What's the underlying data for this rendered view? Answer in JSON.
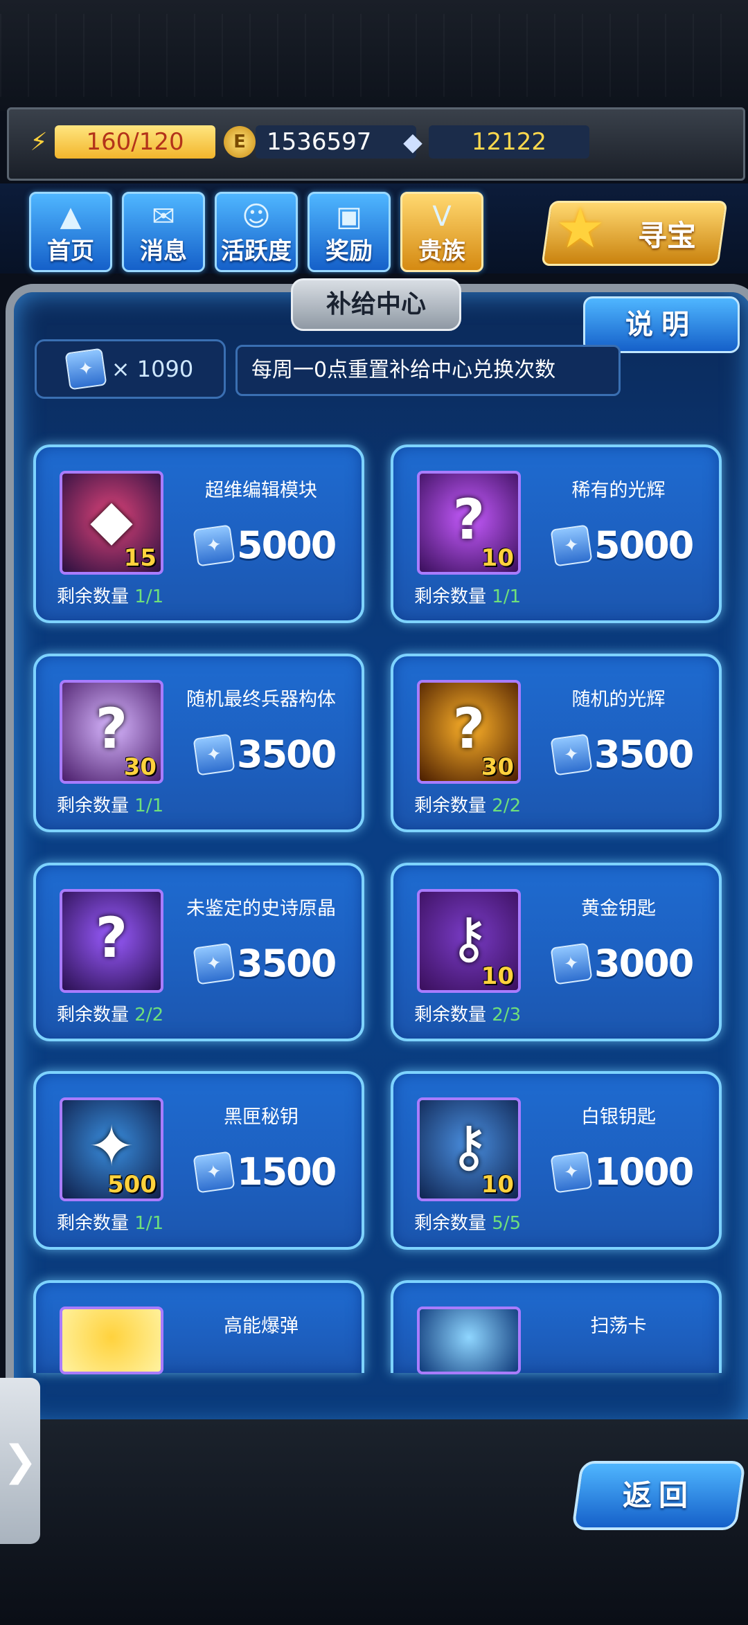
{
  "resources": {
    "energy": "160/120",
    "coins": "1536597",
    "gems": "12122"
  },
  "nav": [
    {
      "label": "首页",
      "icon": "fighter-icon"
    },
    {
      "label": "消息",
      "icon": "mail-icon"
    },
    {
      "label": "活跃度",
      "icon": "smile-icon"
    },
    {
      "label": "奖励",
      "icon": "gift-icon"
    },
    {
      "label": "贵族",
      "icon": "v-badge-icon"
    }
  ],
  "treasure_label": "寻宝",
  "panel": {
    "title": "补给中心",
    "help_label": "说明",
    "ticket_count": "× 1090",
    "notice": "每周一0点重置补给中心兑换次数"
  },
  "remain_label": "剩余数量",
  "items": [
    {
      "name": "超维编辑模块",
      "price": "5000",
      "remain": "1/1",
      "count": "15",
      "glyph": "◆",
      "colors": [
        "#2a1040",
        "#e0447a"
      ]
    },
    {
      "name": "稀有的光辉",
      "price": "5000",
      "remain": "1/1",
      "count": "10",
      "glyph": "?",
      "colors": [
        "#3a0f5c",
        "#c75cff"
      ]
    },
    {
      "name": "随机最终兵器构体",
      "price": "3500",
      "remain": "1/1",
      "count": "30",
      "glyph": "?",
      "colors": [
        "#4a1d6a",
        "#d8b7ff"
      ]
    },
    {
      "name": "随机的光辉",
      "price": "3500",
      "remain": "2/2",
      "count": "30",
      "glyph": "?",
      "colors": [
        "#4a1d00",
        "#ffb32a"
      ]
    },
    {
      "name": "未鉴定的史诗原晶",
      "price": "3500",
      "remain": "2/2",
      "count": "",
      "glyph": "?",
      "colors": [
        "#2a0f50",
        "#9a5cff"
      ]
    },
    {
      "name": "黄金钥匙",
      "price": "3000",
      "remain": "2/3",
      "count": "10",
      "glyph": "⚷",
      "colors": [
        "#3a0f5c",
        "#7a3cc7"
      ]
    },
    {
      "name": "黑匣秘钥",
      "price": "1500",
      "remain": "1/1",
      "count": "500",
      "glyph": "✦",
      "colors": [
        "#0f1f4a",
        "#3a8fe0"
      ]
    },
    {
      "name": "白银钥匙",
      "price": "1000",
      "remain": "5/5",
      "count": "10",
      "glyph": "⚷",
      "colors": [
        "#0f2450",
        "#4a8fe0"
      ]
    },
    {
      "name": "高能爆弹",
      "price": "",
      "remain": "",
      "count": "",
      "glyph": "",
      "colors": [
        "#fff2a0",
        "#ffd23d"
      ]
    },
    {
      "name": "扫荡卡",
      "price": "",
      "remain": "",
      "count": "",
      "glyph": "",
      "colors": [
        "#0f3a7a",
        "#8fd6ff"
      ]
    }
  ],
  "side_tab_label": "❯",
  "back_label": "返回"
}
